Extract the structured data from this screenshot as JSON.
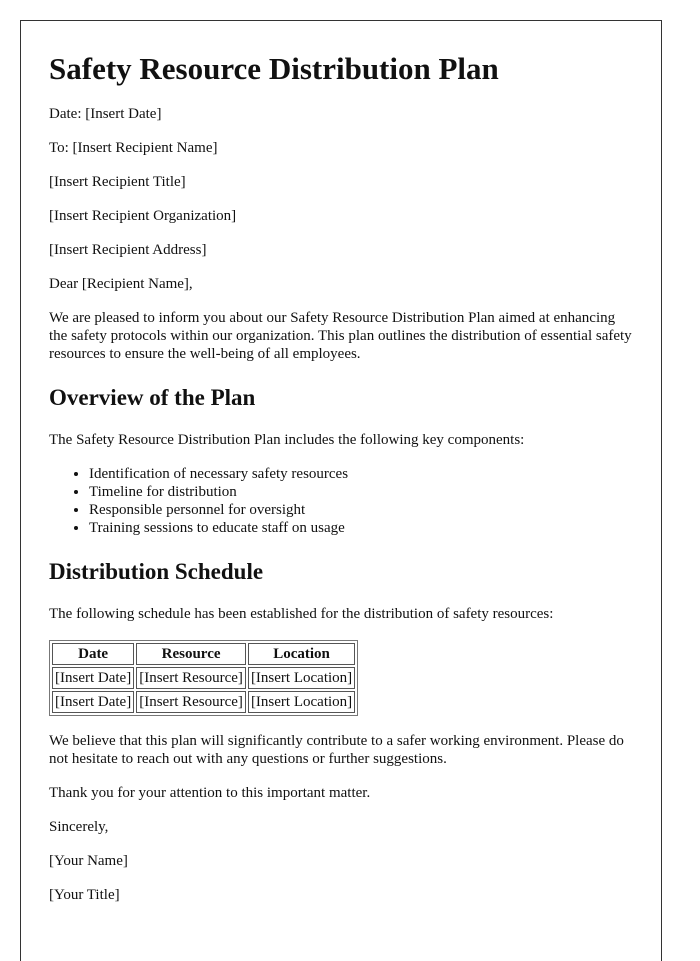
{
  "document": {
    "title": "Safety Resource Distribution Plan",
    "header": {
      "date_line": "Date: [Insert Date]",
      "to_line": "To: [Insert Recipient Name]",
      "recipient_title": "[Insert Recipient Title]",
      "recipient_organization": "[Insert Recipient Organization]",
      "recipient_address": "[Insert Recipient Address]"
    },
    "salutation": "Dear [Recipient Name],",
    "intro": "We are pleased to inform you about our Safety Resource Distribution Plan aimed at enhancing the safety protocols within our organization. This plan outlines the distribution of essential safety resources to ensure the well-being of all employees.",
    "overview": {
      "heading": "Overview of the Plan",
      "lead": "The Safety Resource Distribution Plan includes the following key components:",
      "items": [
        "Identification of necessary safety resources",
        "Timeline for distribution",
        "Responsible personnel for oversight",
        "Training sessions to educate staff on usage"
      ]
    },
    "schedule": {
      "heading": "Distribution Schedule",
      "lead": "The following schedule has been established for the distribution of safety resources:",
      "columns": [
        "Date",
        "Resource",
        "Location"
      ],
      "rows": [
        [
          "[Insert Date]",
          "[Insert Resource]",
          "[Insert Location]"
        ],
        [
          "[Insert Date]",
          "[Insert Resource]",
          "[Insert Location]"
        ]
      ]
    },
    "closing_paragraph": "We believe that this plan will significantly contribute to a safer working environment. Please do not hesitate to reach out with any questions or further suggestions.",
    "thanks": "Thank you for your attention to this important matter.",
    "signoff": "Sincerely,",
    "sender_name": "[Your Name]",
    "sender_title": "[Your Title]"
  }
}
